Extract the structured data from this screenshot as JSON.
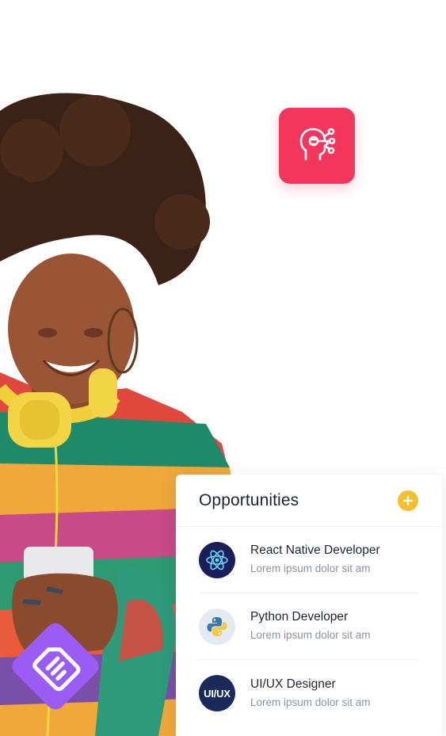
{
  "card": {
    "title": "Opportunities",
    "add_icon": "plus-icon",
    "items": [
      {
        "title": "React Native Developer",
        "subtitle": "Lorem ipsum dolor sit am",
        "icon": "react-icon",
        "icon_bg": "#1a1f5a"
      },
      {
        "title": "Python Developer",
        "subtitle": "Lorem ipsum dolor sit am",
        "icon": "python-icon",
        "icon_bg": "#e4eaf1"
      },
      {
        "title": "UI/UX Designer",
        "subtitle": "Lorem ipsum dolor sit am",
        "icon": "uiux-icon",
        "icon_label": "UI/UX",
        "icon_bg": "#1a2a5a"
      }
    ]
  },
  "badges": {
    "ai_icon": "ai-brain-icon",
    "ai_color": "#f5365c",
    "doc_icon": "document-icon",
    "doc_color": "#9b5cf6"
  },
  "colors": {
    "accent_yellow": "#f4c02e",
    "text_dark": "#1f2433",
    "text_muted": "#8a92a3"
  }
}
